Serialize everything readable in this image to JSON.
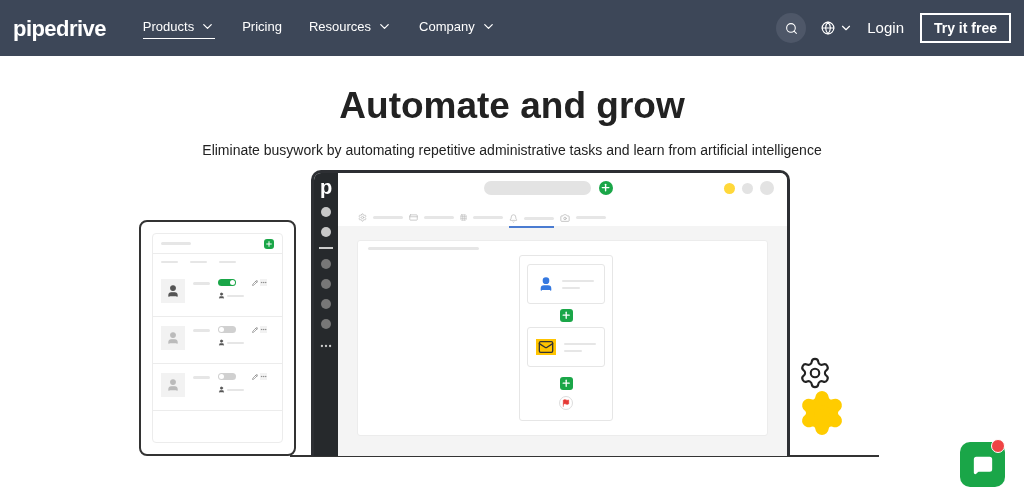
{
  "nav": {
    "logo": "pipedrive",
    "items": [
      {
        "label": "Products",
        "dropdown": true,
        "selected": true
      },
      {
        "label": "Pricing",
        "dropdown": false,
        "selected": false
      },
      {
        "label": "Resources",
        "dropdown": true,
        "selected": false
      },
      {
        "label": "Company",
        "dropdown": true,
        "selected": false
      }
    ],
    "login": "Login",
    "cta": "Try it free"
  },
  "hero": {
    "title": "Automate and grow",
    "subtitle": "Eliminate busywork by automating repetitive administrative tasks and learn from artificial intelligence"
  },
  "illustration": {
    "app_logo": "p",
    "rows": [
      {
        "on": true
      },
      {
        "on": false
      },
      {
        "on": false
      }
    ]
  },
  "chat": {
    "notification": true
  }
}
